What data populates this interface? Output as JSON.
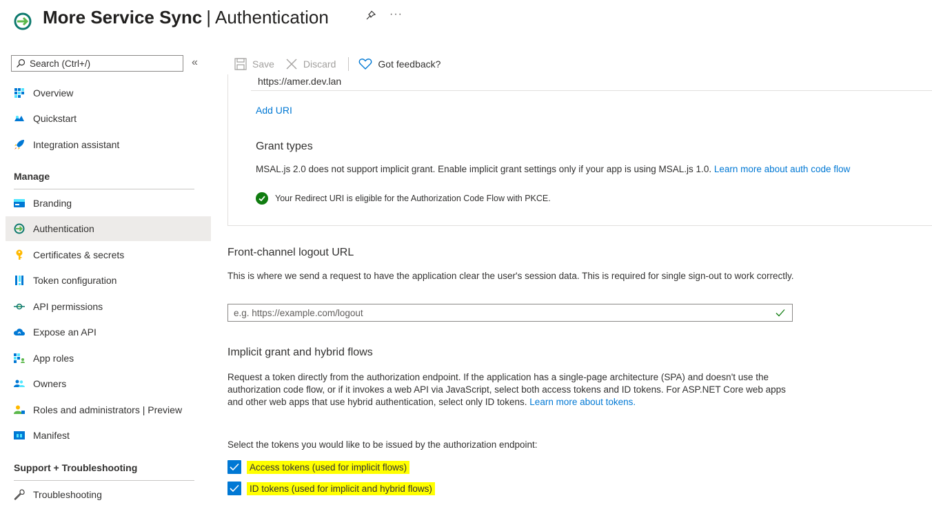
{
  "header": {
    "app_name": "More Service Sync",
    "separator": "|",
    "page": "Authentication",
    "more_label": "···"
  },
  "sidebar": {
    "search_placeholder": "Search (Ctrl+/)",
    "collapse_label": "«",
    "items_top": [
      {
        "label": "Overview",
        "icon": "overview-icon"
      },
      {
        "label": "Quickstart",
        "icon": "quickstart-icon"
      },
      {
        "label": "Integration assistant",
        "icon": "rocket-icon"
      }
    ],
    "manage_heading": "Manage",
    "items_manage": [
      {
        "label": "Branding",
        "icon": "branding-icon"
      },
      {
        "label": "Authentication",
        "icon": "authentication-icon",
        "active": true
      },
      {
        "label": "Certificates & secrets",
        "icon": "key-icon"
      },
      {
        "label": "Token configuration",
        "icon": "token-config-icon"
      },
      {
        "label": "API permissions",
        "icon": "api-permissions-icon"
      },
      {
        "label": "Expose an API",
        "icon": "cloud-icon"
      },
      {
        "label": "App roles",
        "icon": "app-roles-icon"
      },
      {
        "label": "Owners",
        "icon": "owners-icon"
      },
      {
        "label": "Roles and administrators | Preview",
        "icon": "roles-admin-icon"
      },
      {
        "label": "Manifest",
        "icon": "manifest-icon"
      }
    ],
    "support_heading": "Support + Troubleshooting",
    "items_support": [
      {
        "label": "Troubleshooting",
        "icon": "wrench-icon"
      }
    ]
  },
  "toolbar": {
    "save_label": "Save",
    "discard_label": "Discard",
    "feedback_label": "Got feedback?"
  },
  "redirect": {
    "uri_value": "https://amer.dev.lan",
    "add_uri_label": "Add URI"
  },
  "grant": {
    "title": "Grant types",
    "text": "MSAL.js 2.0 does not support implicit grant. Enable implicit grant settings only if your app is using MSAL.js 1.0.",
    "link": "Learn more about auth code flow",
    "status": "Your Redirect URI is eligible for the Authorization Code Flow with PKCE."
  },
  "logout": {
    "title": "Front-channel logout URL",
    "description": "This is where we send a request to have the application clear the user's session data. This is required for single sign-out to work correctly.",
    "placeholder": "e.g. https://example.com/logout"
  },
  "implicit": {
    "title": "Implicit grant and hybrid flows",
    "description": "Request a token directly from the authorization endpoint. If the application has a single-page architecture (SPA) and doesn't use the authorization code flow, or if it invokes a web API via JavaScript, select both access tokens and ID tokens. For ASP.NET Core web apps and other web apps that use hybrid authentication, select only ID tokens.",
    "learn_more": "Learn more about tokens.",
    "select_prompt": "Select the tokens you would like to be issued by the authorization endpoint:",
    "access_tokens_label": "Access tokens (used for implicit flows)",
    "access_tokens_checked": true,
    "id_tokens_label": "ID tokens (used for implicit and hybrid flows)",
    "id_tokens_checked": true
  },
  "colors": {
    "accent": "#0078d4",
    "success": "#107c10",
    "highlight": "#ffff00",
    "active_nav": "#edebe9"
  }
}
